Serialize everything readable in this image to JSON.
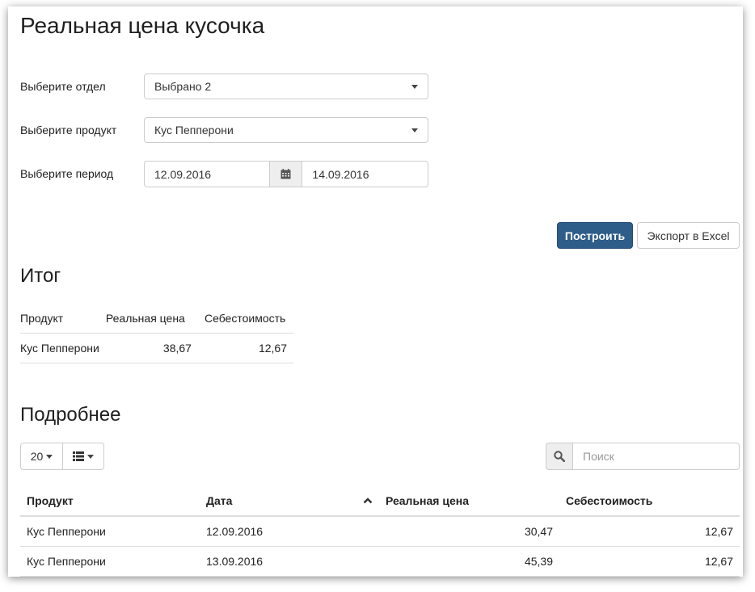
{
  "page": {
    "title": "Реальная цена кусочка"
  },
  "filters": {
    "department": {
      "label": "Выберите отдел",
      "value": "Выбрано 2"
    },
    "product": {
      "label": "Выберите продукт",
      "value": "Кус Пепперони"
    },
    "period": {
      "label": "Выберите период",
      "from": "12.09.2016",
      "to": "14.09.2016"
    }
  },
  "actions": {
    "build_label": "Построить",
    "export_label": "Экспорт в Excel"
  },
  "summary": {
    "title": "Итог",
    "columns": [
      "Продукт",
      "Реальная цена",
      "Себестоимость"
    ],
    "rows": [
      [
        "Кус Пепперони",
        "38,67",
        "12,67"
      ]
    ]
  },
  "details": {
    "title": "Подробнее",
    "page_size": "20",
    "search_placeholder": "Поиск",
    "icons": {
      "search": "search-icon",
      "columns": "list-icon",
      "calendar": "calendar-icon",
      "sort": "chevron-up-icon"
    },
    "columns": [
      "Продукт",
      "Дата",
      "Реальная цена",
      "Себестоимость"
    ],
    "rows": [
      [
        "Кус Пепперони",
        "12.09.2016",
        "30,47",
        "12,67"
      ],
      [
        "Кус Пепперони",
        "13.09.2016",
        "45,39",
        "12,67"
      ]
    ]
  }
}
